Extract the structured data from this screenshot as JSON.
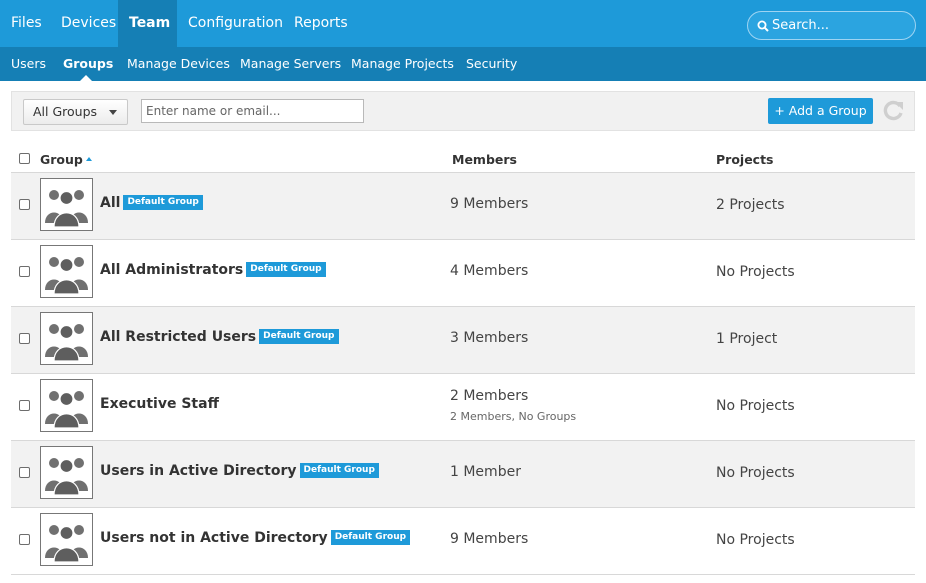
{
  "nav": {
    "items": [
      {
        "label": "Files"
      },
      {
        "label": "Devices"
      },
      {
        "label": "Team"
      },
      {
        "label": "Configuration"
      },
      {
        "label": "Reports"
      }
    ],
    "active": "Team",
    "search_placeholder": "Search..."
  },
  "subnav": {
    "items": [
      {
        "label": "Users"
      },
      {
        "label": "Groups"
      },
      {
        "label": "Manage Devices"
      },
      {
        "label": "Manage Servers"
      },
      {
        "label": "Manage Projects"
      },
      {
        "label": "Security"
      }
    ],
    "active": "Groups"
  },
  "toolbar": {
    "filter_selected": "All Groups",
    "search_placeholder": "Enter name or email...",
    "add_label": "+ Add a Group"
  },
  "table": {
    "columns": [
      "Group",
      "Members",
      "Projects"
    ],
    "sort": "ascending",
    "rows": [
      {
        "name": "All",
        "badge": "Default Group",
        "members": "9 Members",
        "members_detail": "",
        "projects": "2 Projects"
      },
      {
        "name": "All Administrators",
        "badge": "Default Group",
        "members": "4 Members",
        "members_detail": "",
        "projects": "No Projects"
      },
      {
        "name": "All Restricted Users",
        "badge": "Default Group",
        "members": "3 Members",
        "members_detail": "",
        "projects": "1 Project"
      },
      {
        "name": "Executive Staff",
        "badge": "",
        "members": "2 Members",
        "members_detail": "2 Members, No Groups",
        "projects": "No Projects"
      },
      {
        "name": "Users in Active Directory",
        "badge": "Default Group",
        "members": "1 Member",
        "members_detail": "",
        "projects": "No Projects"
      },
      {
        "name": "Users not in Active Directory",
        "badge": "Default Group",
        "members": "9 Members",
        "members_detail": "",
        "projects": "No Projects"
      }
    ]
  },
  "colors": {
    "accent": "#1e9ad9",
    "nav_dark": "#157fb5",
    "row_shade": "#f2f2f2"
  },
  "icons": [
    "search-icon",
    "refresh-icon",
    "group-avatar-icon",
    "sort-ascending-icon",
    "dropdown-caret-icon"
  ]
}
